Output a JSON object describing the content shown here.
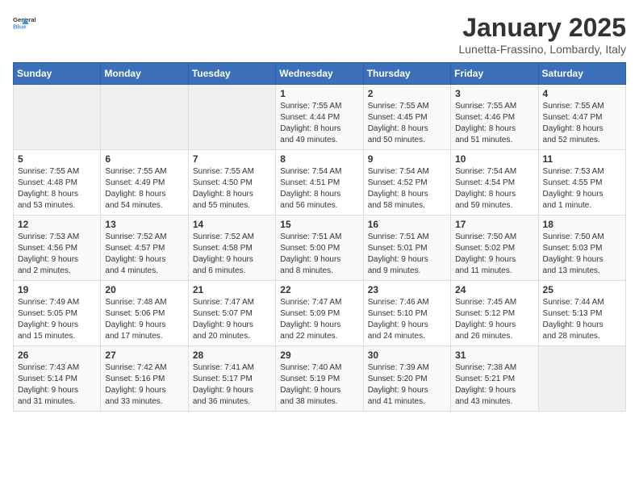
{
  "logo": {
    "text_general": "General",
    "text_blue": "Blue"
  },
  "title": "January 2025",
  "subtitle": "Lunetta-Frassino, Lombardy, Italy",
  "weekdays": [
    "Sunday",
    "Monday",
    "Tuesday",
    "Wednesday",
    "Thursday",
    "Friday",
    "Saturday"
  ],
  "weeks": [
    [
      {
        "day": "",
        "info": ""
      },
      {
        "day": "",
        "info": ""
      },
      {
        "day": "",
        "info": ""
      },
      {
        "day": "1",
        "info": "Sunrise: 7:55 AM\nSunset: 4:44 PM\nDaylight: 8 hours\nand 49 minutes."
      },
      {
        "day": "2",
        "info": "Sunrise: 7:55 AM\nSunset: 4:45 PM\nDaylight: 8 hours\nand 50 minutes."
      },
      {
        "day": "3",
        "info": "Sunrise: 7:55 AM\nSunset: 4:46 PM\nDaylight: 8 hours\nand 51 minutes."
      },
      {
        "day": "4",
        "info": "Sunrise: 7:55 AM\nSunset: 4:47 PM\nDaylight: 8 hours\nand 52 minutes."
      }
    ],
    [
      {
        "day": "5",
        "info": "Sunrise: 7:55 AM\nSunset: 4:48 PM\nDaylight: 8 hours\nand 53 minutes."
      },
      {
        "day": "6",
        "info": "Sunrise: 7:55 AM\nSunset: 4:49 PM\nDaylight: 8 hours\nand 54 minutes."
      },
      {
        "day": "7",
        "info": "Sunrise: 7:55 AM\nSunset: 4:50 PM\nDaylight: 8 hours\nand 55 minutes."
      },
      {
        "day": "8",
        "info": "Sunrise: 7:54 AM\nSunset: 4:51 PM\nDaylight: 8 hours\nand 56 minutes."
      },
      {
        "day": "9",
        "info": "Sunrise: 7:54 AM\nSunset: 4:52 PM\nDaylight: 8 hours\nand 58 minutes."
      },
      {
        "day": "10",
        "info": "Sunrise: 7:54 AM\nSunset: 4:54 PM\nDaylight: 8 hours\nand 59 minutes."
      },
      {
        "day": "11",
        "info": "Sunrise: 7:53 AM\nSunset: 4:55 PM\nDaylight: 9 hours\nand 1 minute."
      }
    ],
    [
      {
        "day": "12",
        "info": "Sunrise: 7:53 AM\nSunset: 4:56 PM\nDaylight: 9 hours\nand 2 minutes."
      },
      {
        "day": "13",
        "info": "Sunrise: 7:52 AM\nSunset: 4:57 PM\nDaylight: 9 hours\nand 4 minutes."
      },
      {
        "day": "14",
        "info": "Sunrise: 7:52 AM\nSunset: 4:58 PM\nDaylight: 9 hours\nand 6 minutes."
      },
      {
        "day": "15",
        "info": "Sunrise: 7:51 AM\nSunset: 5:00 PM\nDaylight: 9 hours\nand 8 minutes."
      },
      {
        "day": "16",
        "info": "Sunrise: 7:51 AM\nSunset: 5:01 PM\nDaylight: 9 hours\nand 9 minutes."
      },
      {
        "day": "17",
        "info": "Sunrise: 7:50 AM\nSunset: 5:02 PM\nDaylight: 9 hours\nand 11 minutes."
      },
      {
        "day": "18",
        "info": "Sunrise: 7:50 AM\nSunset: 5:03 PM\nDaylight: 9 hours\nand 13 minutes."
      }
    ],
    [
      {
        "day": "19",
        "info": "Sunrise: 7:49 AM\nSunset: 5:05 PM\nDaylight: 9 hours\nand 15 minutes."
      },
      {
        "day": "20",
        "info": "Sunrise: 7:48 AM\nSunset: 5:06 PM\nDaylight: 9 hours\nand 17 minutes."
      },
      {
        "day": "21",
        "info": "Sunrise: 7:47 AM\nSunset: 5:07 PM\nDaylight: 9 hours\nand 20 minutes."
      },
      {
        "day": "22",
        "info": "Sunrise: 7:47 AM\nSunset: 5:09 PM\nDaylight: 9 hours\nand 22 minutes."
      },
      {
        "day": "23",
        "info": "Sunrise: 7:46 AM\nSunset: 5:10 PM\nDaylight: 9 hours\nand 24 minutes."
      },
      {
        "day": "24",
        "info": "Sunrise: 7:45 AM\nSunset: 5:12 PM\nDaylight: 9 hours\nand 26 minutes."
      },
      {
        "day": "25",
        "info": "Sunrise: 7:44 AM\nSunset: 5:13 PM\nDaylight: 9 hours\nand 28 minutes."
      }
    ],
    [
      {
        "day": "26",
        "info": "Sunrise: 7:43 AM\nSunset: 5:14 PM\nDaylight: 9 hours\nand 31 minutes."
      },
      {
        "day": "27",
        "info": "Sunrise: 7:42 AM\nSunset: 5:16 PM\nDaylight: 9 hours\nand 33 minutes."
      },
      {
        "day": "28",
        "info": "Sunrise: 7:41 AM\nSunset: 5:17 PM\nDaylight: 9 hours\nand 36 minutes."
      },
      {
        "day": "29",
        "info": "Sunrise: 7:40 AM\nSunset: 5:19 PM\nDaylight: 9 hours\nand 38 minutes."
      },
      {
        "day": "30",
        "info": "Sunrise: 7:39 AM\nSunset: 5:20 PM\nDaylight: 9 hours\nand 41 minutes."
      },
      {
        "day": "31",
        "info": "Sunrise: 7:38 AM\nSunset: 5:21 PM\nDaylight: 9 hours\nand 43 minutes."
      },
      {
        "day": "",
        "info": ""
      }
    ]
  ]
}
